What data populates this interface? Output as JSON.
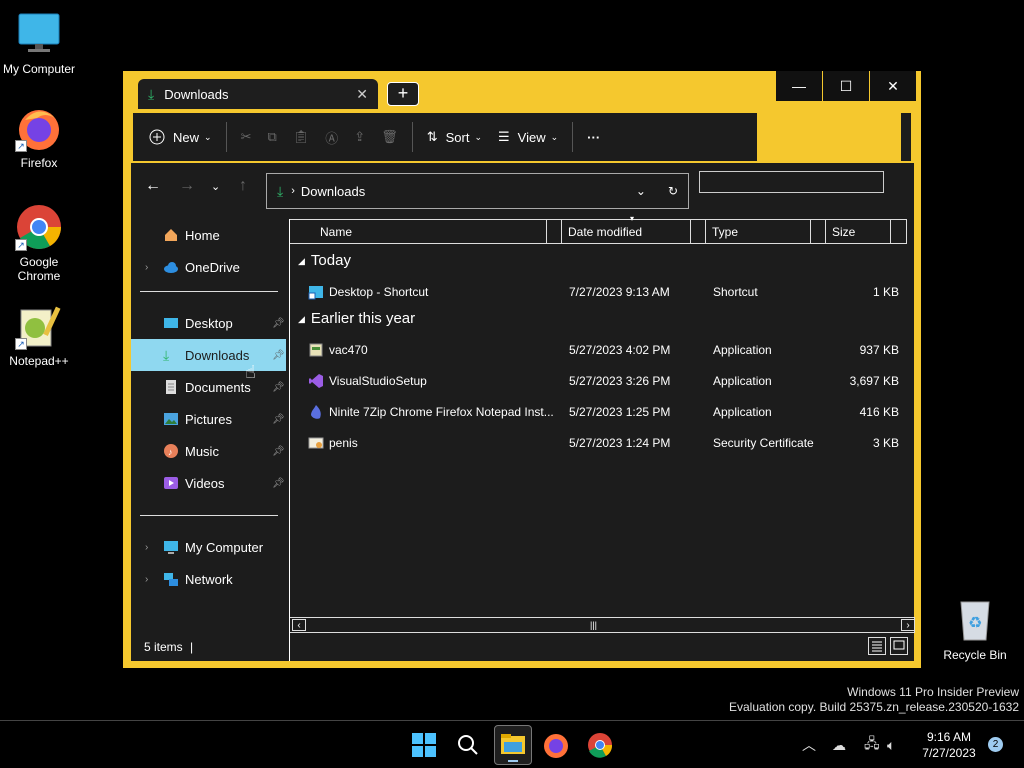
{
  "desktop": {
    "icons": [
      {
        "label": "My Computer"
      },
      {
        "label": "Firefox"
      },
      {
        "label": "Google Chrome"
      },
      {
        "label": "Notepad++"
      }
    ],
    "recycle_bin": "Recycle Bin",
    "watermark_line1": "Windows 11 Pro Insider Preview",
    "watermark_line2": "Evaluation copy. Build 25375.zn_release.230520-1632"
  },
  "window": {
    "tab_title": "Downloads",
    "tab_close": "✕",
    "new_tab": "+",
    "minimize": "—",
    "maximize": "☐",
    "close": "✕"
  },
  "commandbar": {
    "new_label": "New",
    "sort_label": "Sort",
    "view_label": "View",
    "more": "···"
  },
  "address": {
    "path": "Downloads",
    "search_placeholder": ""
  },
  "sidebar": {
    "items": [
      {
        "label": "Home"
      },
      {
        "label": "OneDrive"
      },
      {
        "label": "Desktop"
      },
      {
        "label": "Downloads"
      },
      {
        "label": "Documents"
      },
      {
        "label": "Pictures"
      },
      {
        "label": "Music"
      },
      {
        "label": "Videos"
      },
      {
        "label": "My Computer"
      },
      {
        "label": "Network"
      }
    ]
  },
  "filelist": {
    "columns": {
      "name": "Name",
      "date": "Date modified",
      "type": "Type",
      "size": "Size"
    },
    "groups": [
      {
        "title": "Today"
      },
      {
        "title": "Earlier this year"
      }
    ],
    "rows": [
      {
        "name": "Desktop - Shortcut",
        "date": "7/27/2023 9:13 AM",
        "type": "Shortcut",
        "size": "1 KB",
        "icon": "shortcut-icon"
      },
      {
        "name": "vac470",
        "date": "5/27/2023 4:02 PM",
        "type": "Application",
        "size": "937 KB",
        "icon": "installer-icon"
      },
      {
        "name": "VisualStudioSetup",
        "date": "5/27/2023 3:26 PM",
        "type": "Application",
        "size": "3,697 KB",
        "icon": "visual-studio-icon"
      },
      {
        "name": "Ninite 7Zip Chrome Firefox Notepad Inst...",
        "date": "5/27/2023 1:25 PM",
        "type": "Application",
        "size": "416 KB",
        "icon": "ninite-icon"
      },
      {
        "name": "penis",
        "date": "5/27/2023 1:24 PM",
        "type": "Security Certificate",
        "size": "3 KB",
        "icon": "certificate-icon"
      }
    ]
  },
  "status": {
    "items_count": "5 items",
    "separator": "|"
  },
  "taskbar": {
    "time": "9:16 AM",
    "date": "7/27/2023",
    "notifications": "2"
  },
  "colors": {
    "window_border": "#f5c82e",
    "selection": "#8fd8f0",
    "content_bg": "#1c1c1c",
    "download_green": "#2fb56a"
  }
}
